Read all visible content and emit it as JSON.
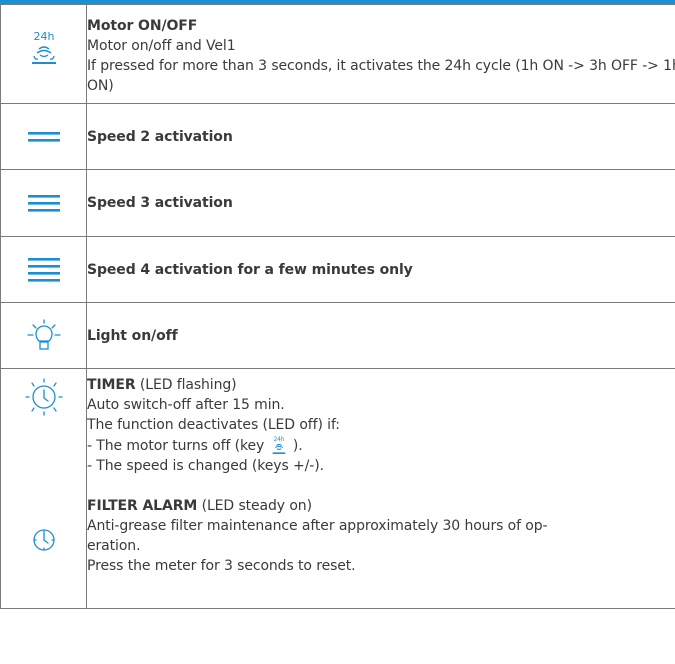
{
  "rows": [
    {
      "icon": "motor-24h-icon",
      "title": "Motor ON/OFF",
      "lines": [
        "Motor on/off and Vel1",
        "If pressed for more than 3 seconds, it activates the 24h cycle (1h ON -> 3h OFF -> 1h ON)"
      ]
    },
    {
      "icon": "speed-2-icon",
      "title": "Speed 2 activation"
    },
    {
      "icon": "speed-3-icon",
      "title": "Speed 3 activation"
    },
    {
      "icon": "speed-4-icon",
      "title": "Speed 4 activation for a few minutes only"
    },
    {
      "icon": "light-bulb-icon",
      "title": "Light on/off"
    }
  ],
  "timer": {
    "icon": "timer-clock-icon",
    "title": "TIMER",
    "title_note": " (LED flashing)",
    "line1": "Auto switch-off after 15 min.",
    "line2": "The function deactivates (LED off) if:",
    "line3_before": "- The motor turns off (key ",
    "line3_icon": "motor-24h-icon",
    "line3_after": " ).",
    "line4": "- The speed is changed (keys +/-)."
  },
  "filter": {
    "icon": "filter-alarm-clock-icon",
    "title": "FILTER ALARM",
    "title_note": " (LED steady on)",
    "line1": "Anti-grease filter maintenance after approximately 30 hours of op-",
    "line2": "eration.",
    "line3": "Press the meter for 3 seconds to reset."
  },
  "icon_24h_text": "24h",
  "colors": {
    "accent": "#1b8fcf",
    "text": "#3a3a3a",
    "border": "#7b7b7b"
  }
}
